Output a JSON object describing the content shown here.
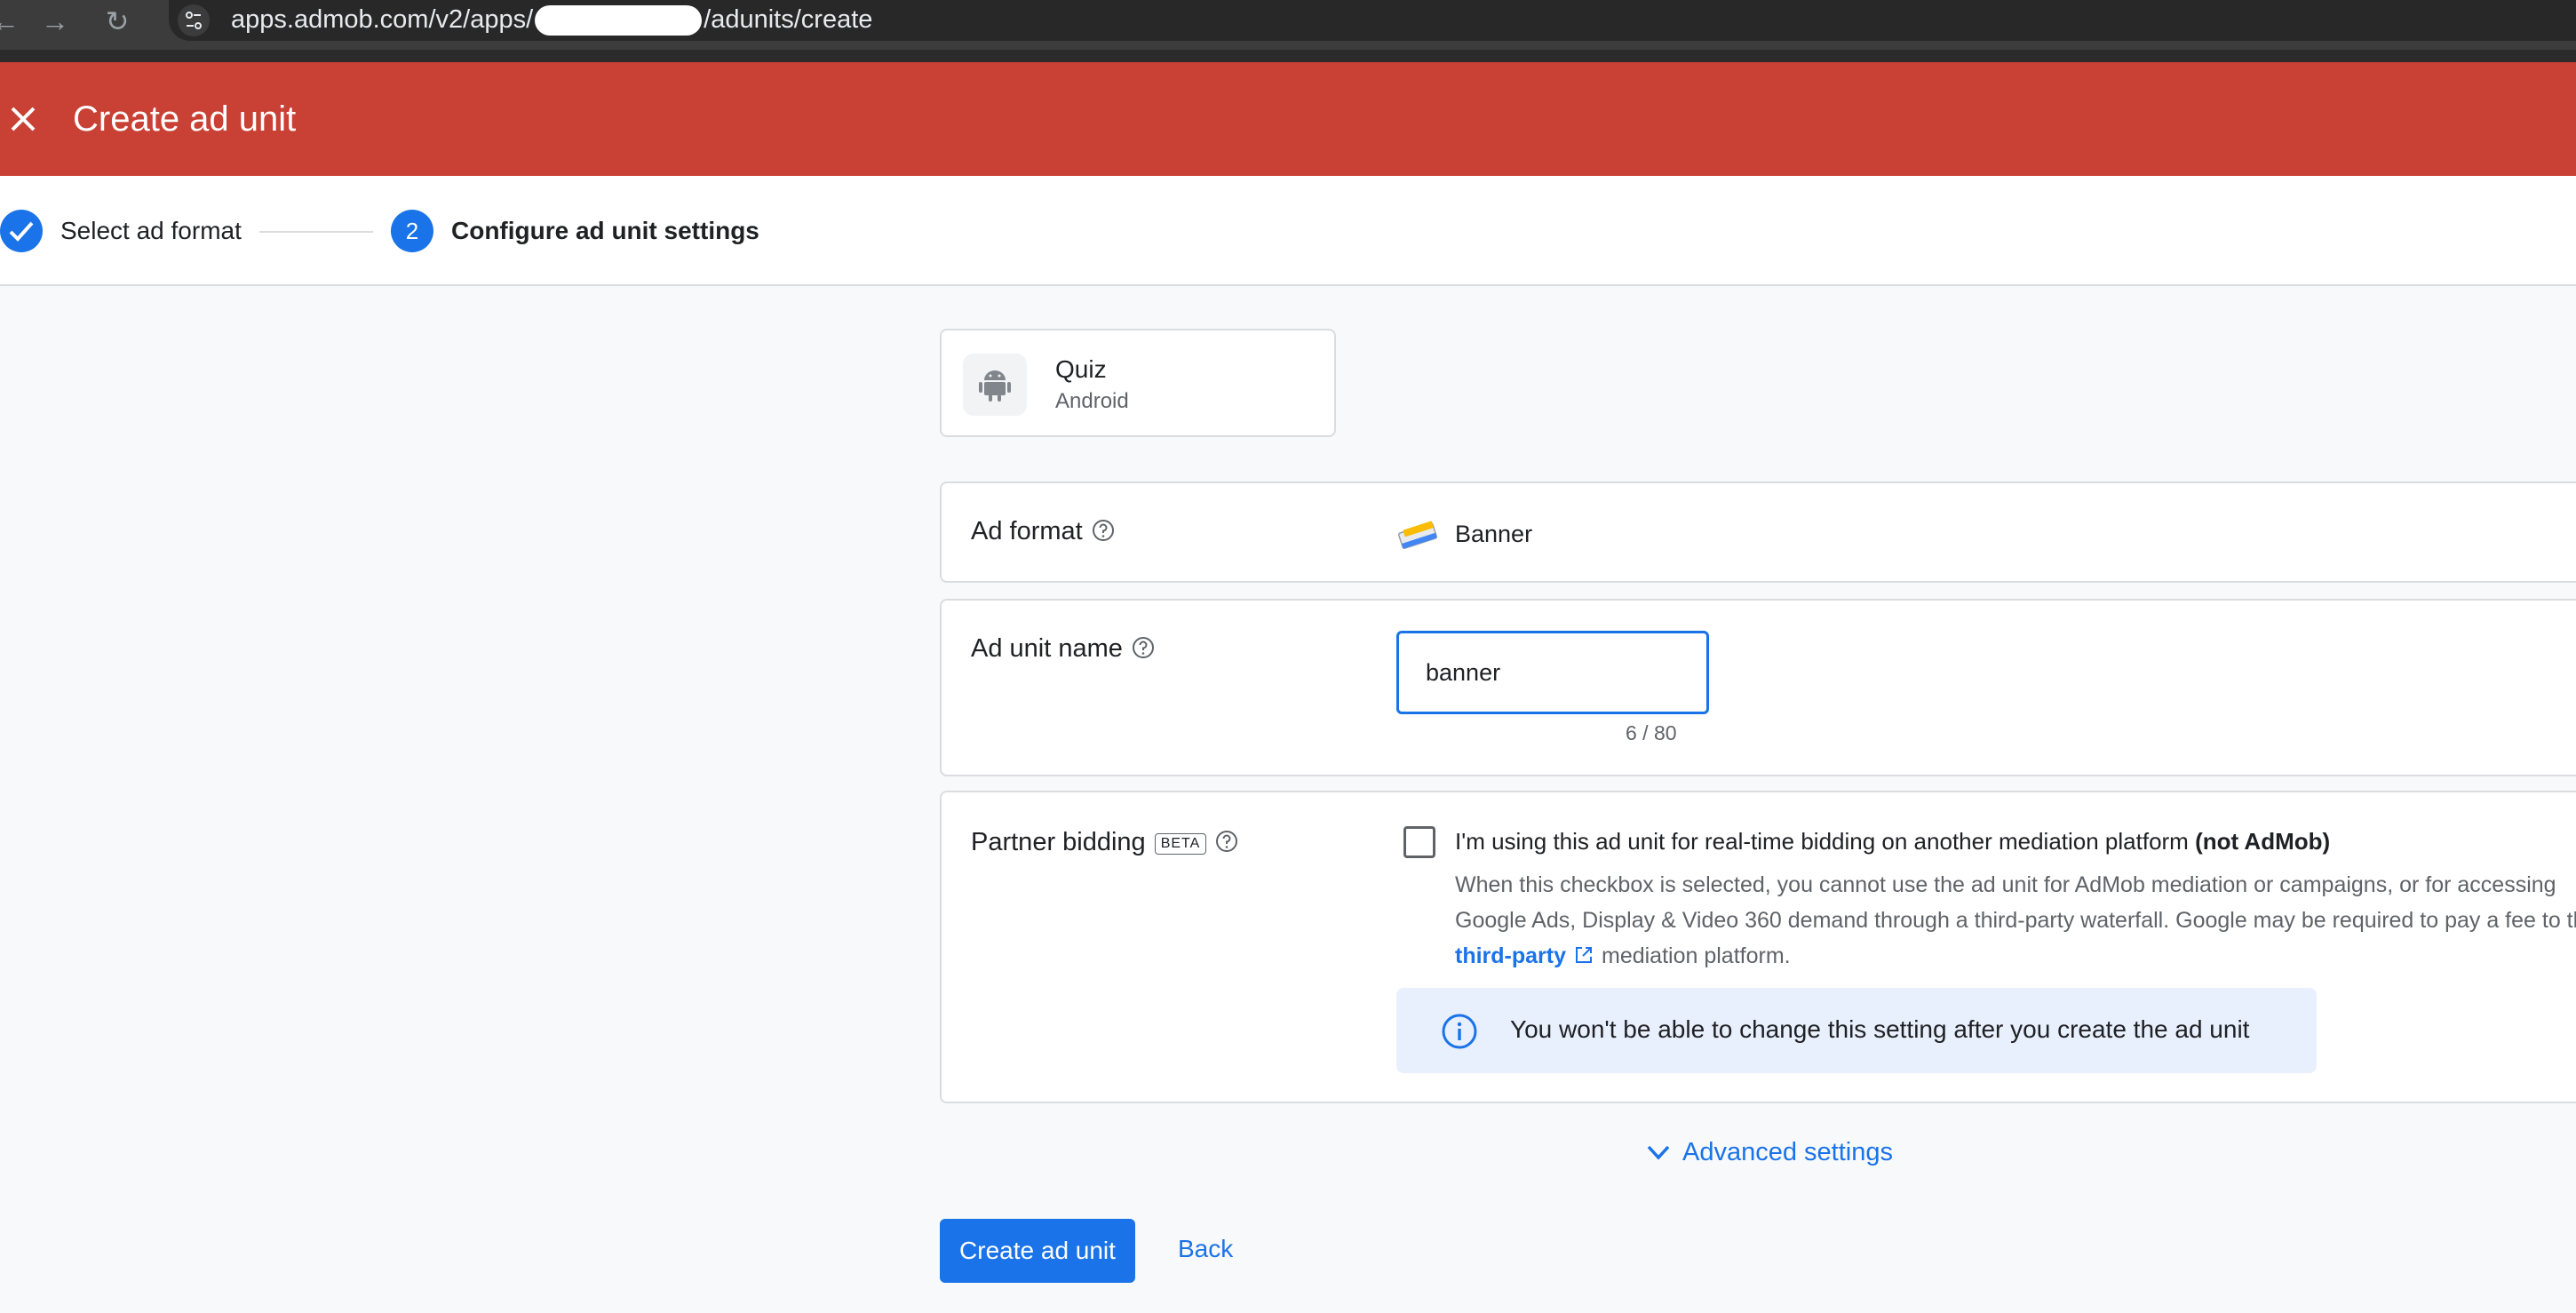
{
  "browser": {
    "url_prefix": "apps.admob.com/v2/apps/",
    "url_suffix": "/adunits/create"
  },
  "header": {
    "title": "Create ad unit"
  },
  "stepper": {
    "step1_label": "Select ad format",
    "step2_number": "2",
    "step2_label": "Configure ad unit settings"
  },
  "app": {
    "name": "Quiz",
    "platform": "Android"
  },
  "ad_format": {
    "label": "Ad format",
    "value": "Banner"
  },
  "ad_unit_name": {
    "label": "Ad unit name",
    "value": "banner",
    "char_count": "6 / 80"
  },
  "partner_bidding": {
    "label": "Partner bidding",
    "badge": "BETA",
    "checkbox_label": "I'm using this ad unit for real-time bidding on another mediation platform",
    "checkbox_label_bold": "(not AdMob)",
    "description_before_link": "When this checkbox is selected, you cannot use the ad unit for AdMob mediation or campaigns, or for accessing Google Ads, Display & Video 360 demand through a third-party waterfall. Google may be required to pay a fee to the",
    "link_text": "third-party",
    "description_after_link": "mediation platform.",
    "info_text": "You won't be able to change this setting after you create the ad unit",
    "checked": false
  },
  "actions": {
    "advanced_settings": "Advanced settings",
    "create_label": "Create ad unit",
    "back_label": "Back"
  },
  "colors": {
    "header_red": "#c94034",
    "primary_blue": "#1a73e8",
    "info_bg": "#e8f0fe"
  }
}
